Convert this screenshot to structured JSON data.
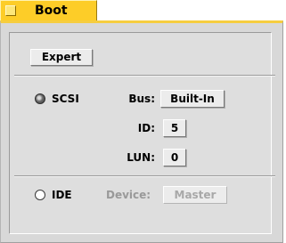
{
  "tab": {
    "title": "Boot"
  },
  "expert_button": {
    "label": "Expert"
  },
  "scsi": {
    "label": "SCSI",
    "selected": true,
    "bus": {
      "label": "Bus:",
      "value": "Built-In"
    },
    "id": {
      "label": "ID:",
      "value": "5"
    },
    "lun": {
      "label": "LUN:",
      "value": "0"
    }
  },
  "ide": {
    "label": "IDE",
    "selected": false,
    "device": {
      "label": "Device:",
      "value": "Master"
    }
  },
  "colors": {
    "tab": "#fdcd28",
    "panel": "#d8d8d8",
    "disabled_text": "#a8a8a8"
  }
}
